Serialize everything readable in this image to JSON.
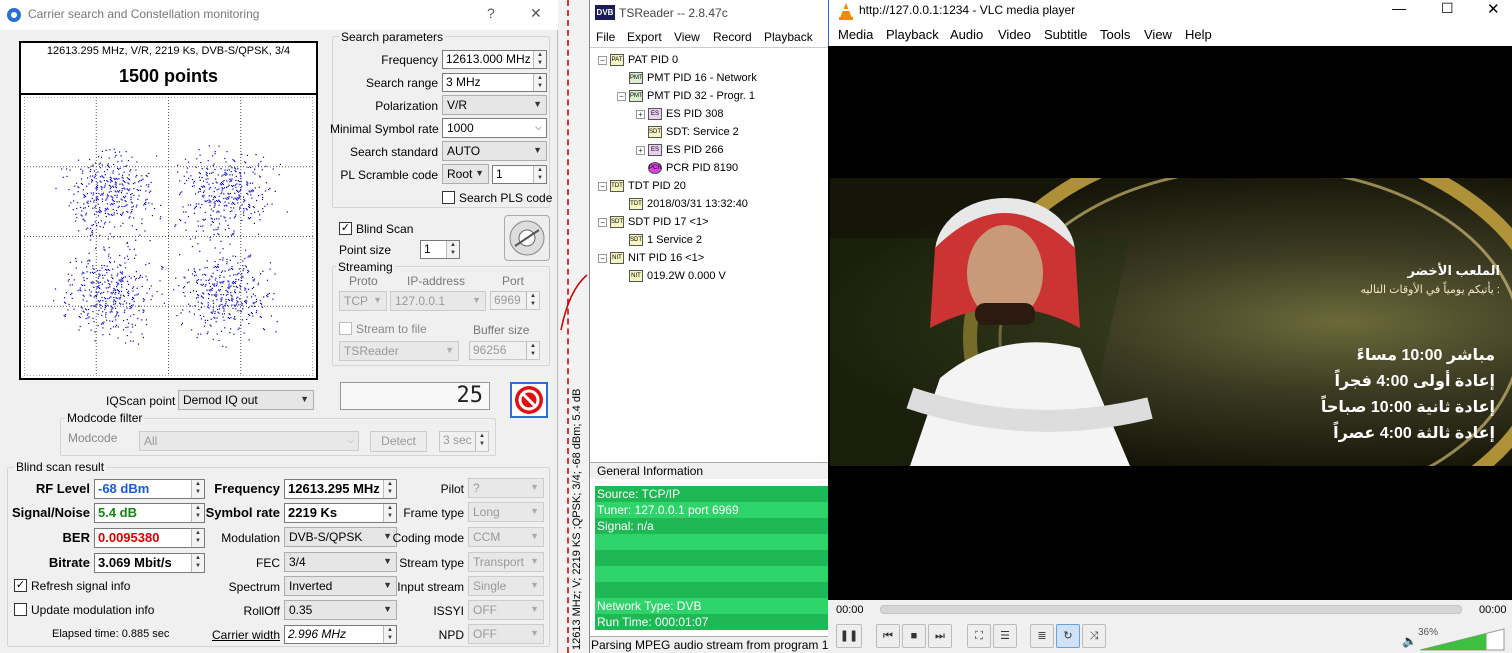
{
  "carrier": {
    "title": "Carrier search and Constellation monitoring",
    "help": "?",
    "close": "✕",
    "constellation": {
      "info": "12613.295 MHz, V/R, 2219 Ks, DVB-S/QPSK, 3/4",
      "points_label": "1500 points",
      "point_count": 1500,
      "dot_color": "#0000cc"
    },
    "search": {
      "group": "Search parameters",
      "frequency_label": "Frequency",
      "frequency": "12613.000 MHz",
      "range_label": "Search range",
      "range": "3 MHz",
      "polarization_label": "Polarization",
      "polarization": "V/R",
      "minsym_label": "Minimal Symbol rate",
      "minsym": "1000",
      "standard_label": "Search standard",
      "standard": "AUTO",
      "pl_label": "PL Scramble code",
      "pl_mode": "Root",
      "pl_value": "1",
      "pls_label": "Search PLS code"
    },
    "blind_scan_label": "Blind Scan",
    "point_size_label": "Point size",
    "point_size": "1",
    "streaming": {
      "group": "Streaming",
      "proto_label": "Proto",
      "ip_label": "IP-address",
      "port_label": "Port",
      "proto": "TCP",
      "ip": "127.0.0.1",
      "port": "6969",
      "to_file_label": "Stream to file",
      "buffer_label": "Buffer size",
      "target": "TSReader",
      "buffer": "96256"
    },
    "iq_label": "IQScan point",
    "iq": "Demod IQ out",
    "counter": "25",
    "modcode": {
      "group": "Modcode filter",
      "label": "Modcode",
      "value": "All",
      "detect": "Detect",
      "timeout": "3 sec"
    },
    "result": {
      "group": "Blind scan result",
      "rf_label": "RF Level",
      "rf": "-68 dBm",
      "rf_color": "#1a5adc",
      "sn_label": "Signal/Noise",
      "sn": "5.4 dB",
      "sn_color": "#118811",
      "ber_label": "BER",
      "ber": "0.0095380",
      "ber_color": "#dd0000",
      "bitrate_label": "Bitrate",
      "bitrate": "3.069 Mbit/s",
      "freq_label": "Frequency",
      "freq": "12613.295 MHz",
      "sym_label": "Symbol rate",
      "sym": "2219 Ks",
      "mod_label": "Modulation",
      "mod": "DVB-S/QPSK",
      "fec_label": "FEC",
      "fec": "3/4",
      "spectrum_label": "Spectrum",
      "spectrum": "Inverted",
      "rolloff_label": "RollOff",
      "rolloff": "0.35",
      "cw_label": "Carrier width",
      "cw": "2.996 MHz",
      "pilot_label": "Pilot",
      "pilot": "?",
      "frame_label": "Frame type",
      "frame": "Long",
      "coding_label": "Coding mode",
      "coding": "CCM",
      "stype_label": "Stream type",
      "stype": "Transport",
      "istream_label": "Input stream",
      "istream": "Single",
      "issyi_label": "ISSYI",
      "issyi": "OFF",
      "npd_label": "NPD",
      "npd": "OFF",
      "refresh_label": "Refresh signal info",
      "update_label": "Update modulation info",
      "elapsed": "Elapsed time: 0.885 sec"
    }
  },
  "strip": {
    "text": "12613 MHz; V; 2219 KS ;QPSK; 3/4; -68 dBm; 5.4 dB"
  },
  "tsreader": {
    "title": "TSReader -- 2.8.47c",
    "logo": "DVB",
    "menu": [
      "File",
      "Export",
      "View",
      "Record",
      "Playback"
    ],
    "tree": [
      {
        "label": "PAT PID 0",
        "icon": "PAT"
      },
      {
        "label": "PMT PID 16 - Network",
        "icon": "PMT"
      },
      {
        "label": "PMT PID 32 - Progr. 1",
        "icon": "PMT"
      },
      {
        "label": "ES PID 308",
        "icon": "ES"
      },
      {
        "label": "SDT: Service 2",
        "icon": "SDT"
      },
      {
        "label": "ES PID 266",
        "icon": "ES"
      },
      {
        "label": "PCR PID 8190",
        "icon": "PCR"
      },
      {
        "label": "TDT PID 20",
        "icon": "TDT"
      },
      {
        "label": "2018/03/31 13:32:40",
        "icon": "TDT"
      },
      {
        "label": "SDT PID 17 <1>",
        "icon": "SDT"
      },
      {
        "label": "1 Service 2",
        "icon": "SDT"
      },
      {
        "label": "NIT PID 16 <1>",
        "icon": "NIT"
      },
      {
        "label": "019.2W 0.000 V",
        "icon": "NIT"
      }
    ],
    "gi_title": "General Information",
    "gi": [
      "Source: TCP/IP",
      "Tuner: 127.0.0.1 port 6969",
      "Signal: n/a",
      "",
      "",
      "",
      "",
      "Network Type: DVB",
      "Run Time: 000:01:07"
    ],
    "status": "Parsing MPEG audio stream from program 1 a"
  },
  "vlc": {
    "title": "http://127.0.0.1:1234 - VLC media player",
    "menu": [
      "Media",
      "Playback",
      "Audio",
      "Video",
      "Subtitle",
      "Tools",
      "View",
      "Help"
    ],
    "overlay": {
      "heading": "الملعب الأخضر",
      "sub": "يأتيكم يومياً في الأوقات التاليه :",
      "lines": [
        "مباشر 10:00 مساءً",
        "إعادة أولى 4:00 فجراً",
        "إعادة ثانية 10:00 صباحاً",
        "إعادة ثالثة 4:00 عصراً"
      ]
    },
    "time_left": "00:00",
    "time_right": "00:00",
    "volume": "36%",
    "volume_level": 0.36
  }
}
